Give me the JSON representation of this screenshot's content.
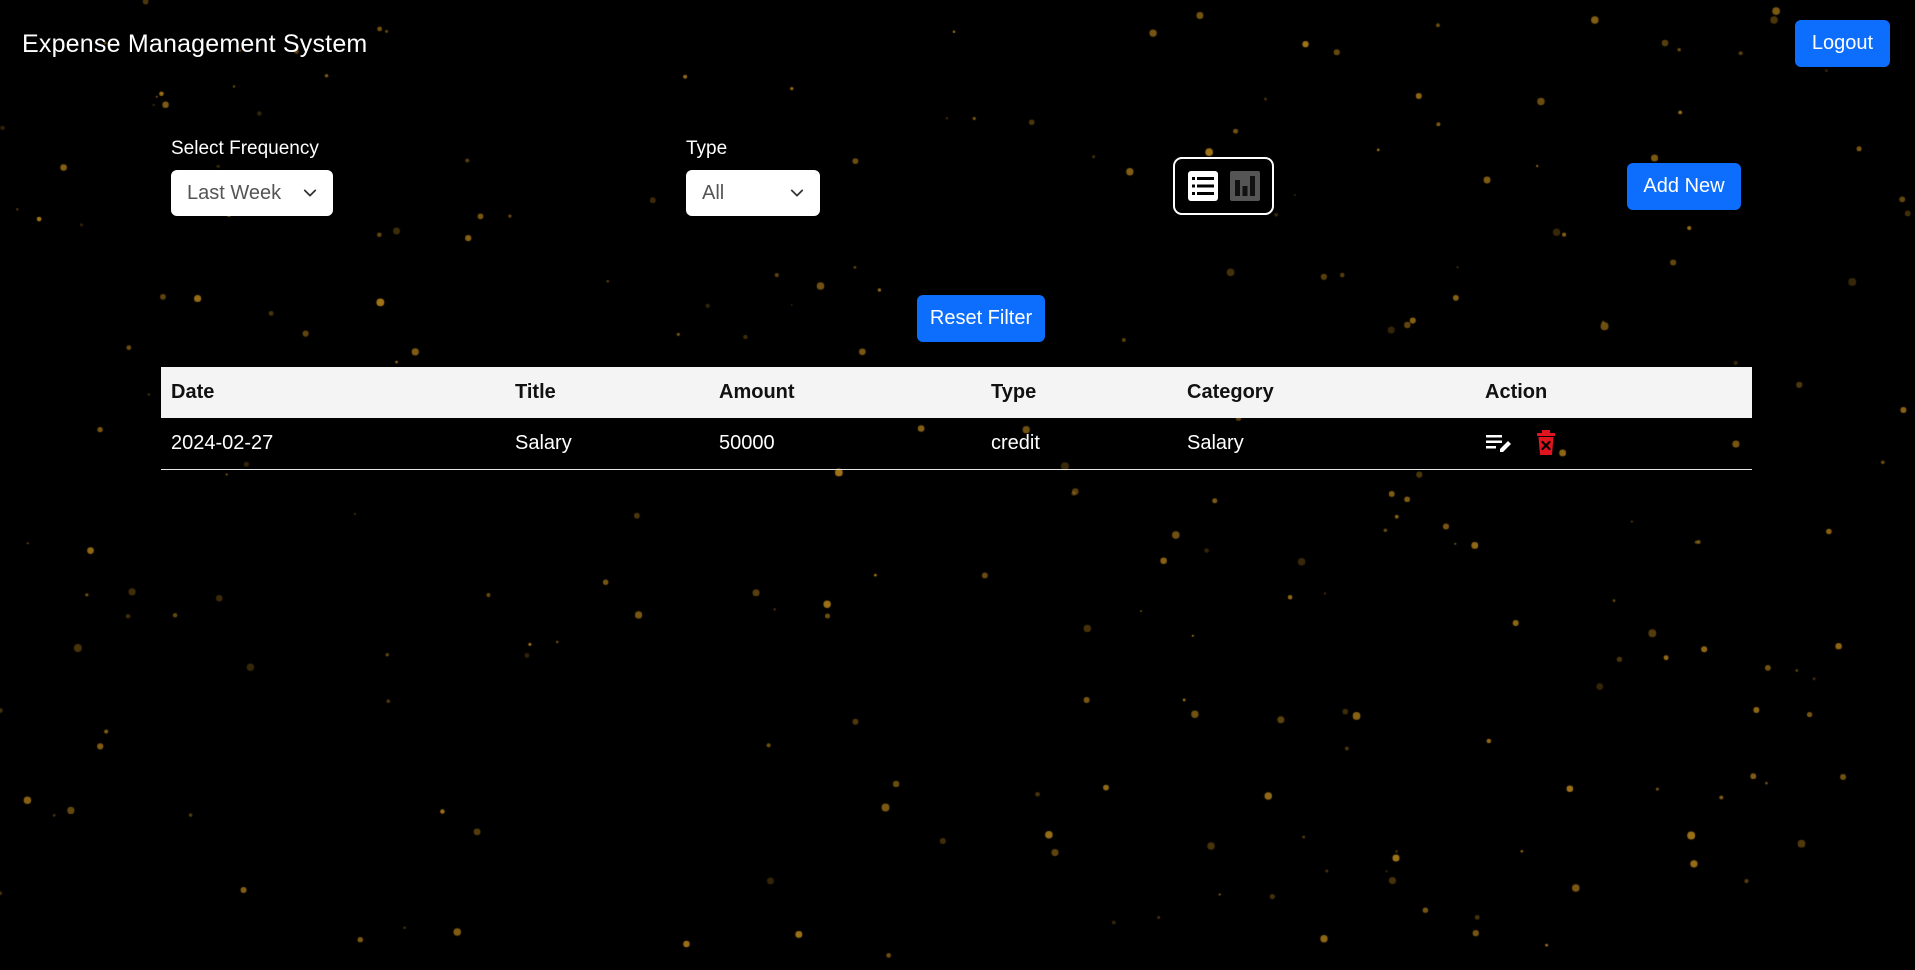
{
  "app": {
    "title": "Expense Management System",
    "logout_label": "Logout"
  },
  "filters": {
    "frequency_label": "Select Frequency",
    "frequency_value": "Last Week",
    "type_label": "Type",
    "type_value": "All",
    "reset_label": "Reset Filter",
    "add_new_label": "Add New"
  },
  "view_toggle": {
    "list_icon": "list-icon",
    "chart_icon": "bar-chart-icon",
    "active": "list"
  },
  "table": {
    "headers": [
      "Date",
      "Title",
      "Amount",
      "Type",
      "Category",
      "Action"
    ],
    "rows": [
      {
        "date": "2024-02-27",
        "title": "Salary",
        "amount": "50000",
        "type": "credit",
        "category": "Salary"
      }
    ]
  },
  "colors": {
    "primary": "#0d6efd",
    "background": "#000000",
    "particle": "#c8901e",
    "delete": "#e0141e",
    "header_bg": "#f4f4f4"
  }
}
